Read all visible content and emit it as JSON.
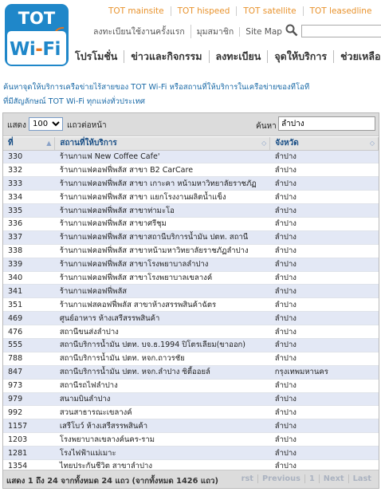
{
  "header": {
    "logo_top": "TOT",
    "logo_bottom_a": "Wi",
    "logo_dash": "-",
    "logo_bottom_b": "Fi",
    "top_links": [
      "TOT mainsite",
      "TOT hispeed",
      "TOT satellite",
      "TOT leasedline"
    ],
    "sub_links": [
      "ลงทะเบียนใช้งานครั้งแรก",
      "มุมสมาชิก",
      "Site Map"
    ],
    "nav": [
      "โปรโมชั่น",
      "ข่าวและกิจกรรม",
      "ลงทะเบียน",
      "จุดให้บริการ",
      "ช่วยเหลือ"
    ]
  },
  "intro": {
    "line1": "ค้นหาจุดให้บริการเครือข่ายไร้สายของ TOT Wi-Fi หรือสถานที่ให้บริการในเครือข่ายของทีโอที",
    "line2": "ที่มีสัญลักษณ์ TOT Wi-Fi ทุกแห่งทั่วประเทศ"
  },
  "toolbar": {
    "show_label": "แสดง",
    "page_size": "100",
    "per_page_label": "แถวต่อหน้า",
    "search_label": "ค้นหา",
    "search_value": "ลำปาง"
  },
  "table": {
    "columns": [
      "ที่",
      "สถานที่ให้บริการ",
      "จังหวัด"
    ],
    "rows": [
      {
        "id": "330",
        "name": "ร้านกาแฟ New Coffee Cafe'",
        "province": "ลำปาง"
      },
      {
        "id": "332",
        "name": "ร้านกาแฟคอฟฟี่พลัส สาขา B2 CarCare",
        "province": "ลำปาง"
      },
      {
        "id": "333",
        "name": "ร้านกาแฟคอฟฟี่พลัส สาขา เกาะคา หน้ามหาวิทยาลัยราชภัฏ",
        "province": "ลำปาง"
      },
      {
        "id": "334",
        "name": "ร้านกาแฟคอฟฟี่พลัส สาขา แยกโรงงานผลิตน้ำแข็ง",
        "province": "ลำปาง"
      },
      {
        "id": "335",
        "name": "ร้านกาแฟคอฟฟี่พลัส สาขาท่ามะโอ",
        "province": "ลำปาง"
      },
      {
        "id": "336",
        "name": "ร้านกาแฟคอฟฟี่พลัส สาขาศรีชุม",
        "province": "ลำปาง"
      },
      {
        "id": "337",
        "name": "ร้านกาแฟคอฟฟี่พลัส สาขาสถานีบริการน้ำมัน ปตท. สถานี",
        "province": "ลำปาง"
      },
      {
        "id": "338",
        "name": "ร้านกาแฟคอฟฟี่พลัส สาขาหน้ามหาวิทยาลัยราชภัฏลำปาง",
        "province": "ลำปาง"
      },
      {
        "id": "339",
        "name": "ร้านกาแฟคอฟฟี่พลัส สาขาโรงพยาบาลลำปาง",
        "province": "ลำปาง"
      },
      {
        "id": "340",
        "name": "ร้านกาแฟคอฟฟี่พลัส สาขาโรงพยาบาลเขลางค์",
        "province": "ลำปาง"
      },
      {
        "id": "341",
        "name": "ร้านกาแฟคอฟฟี่พลัส",
        "province": "ลำปาง"
      },
      {
        "id": "351",
        "name": "ร้านกาแฟสคอฟฟี่พลัส สาขาห้างสรรพสินค้าฉัตร",
        "province": "ลำปาง"
      },
      {
        "id": "469",
        "name": "ศูนย์อาหาร ห้างเสรีสรรพสินค้า",
        "province": "ลำปาง"
      },
      {
        "id": "476",
        "name": "สถานีขนส่งลำปาง",
        "province": "ลำปาง"
      },
      {
        "id": "555",
        "name": "สถานีบริการน้ำมัน ปตท. บจ.ธ.1994 ปิโตรเลียม(ขาออก)",
        "province": "ลำปาง"
      },
      {
        "id": "788",
        "name": "สถานีบริการน้ำมัน ปตท. หจก.ถาวรชัย",
        "province": "ลำปาง"
      },
      {
        "id": "847",
        "name": "สถานีบริการน้ำมัน ปตท. หจก.ลำปาง ซิตี้ออยล์",
        "province": "กรุงเทพมหานคร"
      },
      {
        "id": "973",
        "name": "สถานีรถไฟลำปาง",
        "province": "ลำปาง"
      },
      {
        "id": "979",
        "name": "สนามบินลำปาง",
        "province": "ลำปาง"
      },
      {
        "id": "992",
        "name": "สวนสาธารณะเขลางค์",
        "province": "ลำปาง"
      },
      {
        "id": "1157",
        "name": "เสรีโบว์ ห้างเสรีสรรพสินค้า",
        "province": "ลำปาง"
      },
      {
        "id": "1203",
        "name": "โรงพยาบาลเขลางค์นคร-ราม",
        "province": "ลำปาง"
      },
      {
        "id": "1281",
        "name": "โรงไฟฟ้าแม่เมาะ",
        "province": "ลำปาง"
      },
      {
        "id": "1354",
        "name": "ไทยประกันชีวิต สาขาลำปาง",
        "province": "ลำปาง"
      }
    ]
  },
  "footer": {
    "info": "แสดง 1 ถึง 24 จากทั้งหมด 24 แถว (จากทั้งหมด 1426 แถว)",
    "pager": [
      "rst",
      "Previous",
      "1",
      "Next",
      "Last"
    ]
  },
  "colors": {
    "brand_blue": "#1f87c9",
    "top_link_orange": "#e8922c",
    "intro_text": "#1a6aa7",
    "row_odd": "#e3e8f5",
    "header_text": "#1a4f86"
  }
}
